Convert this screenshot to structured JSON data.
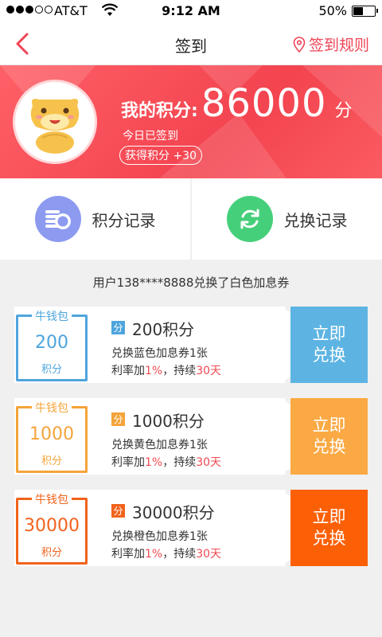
{
  "status_bar": {
    "carrier": "AT&T",
    "time": "9:12 AM",
    "battery": "50%"
  },
  "nav": {
    "title": "签到",
    "rules_label": "签到规则"
  },
  "header": {
    "points_label": "我的积分:",
    "points_value": "86000",
    "points_unit": "分",
    "signed_text": "今日已签到",
    "earned_text": "获得积分 +30"
  },
  "records": {
    "points_record_label": "积分记录",
    "exchange_record_label": "兑换记录"
  },
  "notice": "用户138****8888兑换了白色加息券",
  "coupons": [
    {
      "stamp_title": "牛钱包",
      "stamp_amount": "200",
      "stamp_unit": "积分",
      "tag": "分",
      "points": "200积分",
      "desc": "兑换蓝色加息券1张",
      "terms_prefix": "利率加",
      "rate": "1%",
      "terms_mid": "，持续",
      "duration": "30天",
      "btn_line1": "立即",
      "btn_line2": "兑换",
      "color": "#4ea5dd",
      "btn_color": "#5db4e3"
    },
    {
      "stamp_title": "牛钱包",
      "stamp_amount": "1000",
      "stamp_unit": "积分",
      "tag": "分",
      "points": "1000积分",
      "desc": "兑换黄色加息券1张",
      "terms_prefix": "利率加",
      "rate": "1%",
      "terms_mid": "，持续",
      "duration": "30天",
      "btn_line1": "立即",
      "btn_line2": "兑换",
      "color": "#f4a43a",
      "btn_color": "#fba944"
    },
    {
      "stamp_title": "牛钱包",
      "stamp_amount": "30000",
      "stamp_unit": "积分",
      "tag": "分",
      "points": "30000积分",
      "desc": "兑换橙色加息券1张",
      "terms_prefix": "利率加",
      "rate": "1%",
      "terms_mid": "，持续",
      "duration": "30天",
      "btn_line1": "立即",
      "btn_line2": "兑换",
      "color": "#f1631c",
      "btn_color": "#fc6007"
    }
  ],
  "icons": {
    "back": "chevron-left-icon",
    "rules": "location-pin-icon",
    "points_record": "coin-stack-icon",
    "exchange_record": "refresh-icon"
  }
}
